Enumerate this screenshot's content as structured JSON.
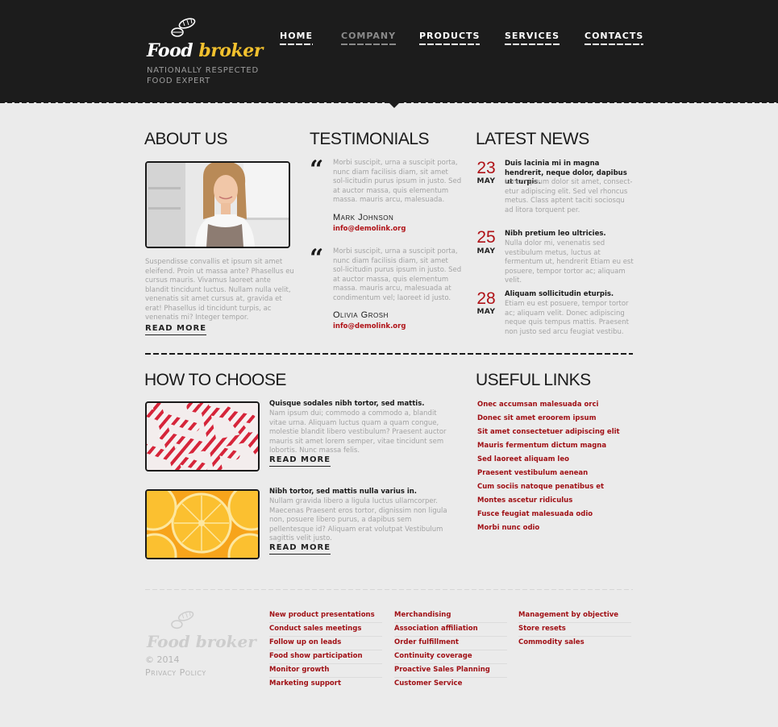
{
  "brand": {
    "word1": "Food",
    "word2": "broker",
    "slogan": "NATIONALLY RESPECTED FOOD EXPERT"
  },
  "nav": {
    "items": [
      {
        "label": "HOME"
      },
      {
        "label": "COMPANY"
      },
      {
        "label": "PRODUCTS"
      },
      {
        "label": "SERVICES"
      },
      {
        "label": "CONTACTS"
      }
    ],
    "active": "COMPANY"
  },
  "about": {
    "title": "ABOUT US",
    "text": "Suspendisse convallis et ipsum sit amet eleifend. Proin ut massa ante? Phasellus eu cursus mauris. Vivamus laoreet ante blandit tincidunt luctus. Nullam nulla velit, venenatis sit amet cursus at, gravida et erat! Phasellus id tincidunt turpis, ac venenatis mi? Integer tempor.",
    "more": "READ MORE"
  },
  "testimonials": {
    "title": "TESTIMONIALS",
    "items": [
      {
        "text": "Morbi suscipit, urna a suscipit porta, nunc diam facilisis diam, sit amet sol-licitudin purus ipsum in justo. Sed at auctor massa, quis elementum massa. mauris arcu, malesuada.",
        "name": "Mark Johnson",
        "email": "info@demolink.org"
      },
      {
        "text": "Morbi suscipit, urna a suscipit porta, nunc diam facilisis diam, sit amet sol-licitudin purus ipsum in justo. Sed at auctor massa, quis elementum massa. mauris arcu, malesuada at condimentum vel; laoreet id justo.",
        "name": "Olivia Grosh",
        "email": "info@demolink.org"
      }
    ]
  },
  "news": {
    "title": "LATEST NEWS",
    "items": [
      {
        "day": "23",
        "month": "MAY",
        "title": "Duis lacinia mi in magna hendrerit, neque dolor, dapibus ut turpis.",
        "text": "Lorem ipsum dolor sit amet, consect-etur adipiscing elit. Sed vel rhoncus metus. Class aptent taciti sociosqu ad litora torquent per."
      },
      {
        "day": "25",
        "month": "MAY",
        "title": "Nibh pretium leo ultricies.",
        "text": "Nulla dolor mi, venenatis sed vestibulum metus, luctus at fermentum ut, hendrerit Etiam eu est posuere, tempor tortor ac; aliquam velit."
      },
      {
        "day": "28",
        "month": "MAY",
        "title": "Aliquam sollicitudin eturpis.",
        "text": "Etiam eu est posuere, tempor tortor ac; aliquam velit. Donec adipiscing neque quis tempus mattis. Praesent non justo sed arcu feugiat vestibu."
      }
    ]
  },
  "choose": {
    "title": "HOW TO CHOOSE",
    "items": [
      {
        "title": "Quisque sodales nibh tortor, sed mattis.",
        "text": "Nam ipsum dui; commodo a commodo a, blandit vitae urna. Aliquam luctus quam a quam congue, molestie blandit libero vestibulum? Praesent auctor mauris sit amet lorem semper, vitae tincidunt sem lobortis. Nunc massa felis.",
        "more": "READ MORE"
      },
      {
        "title": "Nibh tortor, sed mattis nulla varius in.",
        "text": "Nullam gravida libero a ligula luctus ullamcorper. Maecenas Praesent eros tortor, dignissim non ligula non, posuere libero purus, a dapibus sem pellentesque id? Aliquam erat volutpat Vestibulum sagittis velit justo.",
        "more": "READ MORE"
      }
    ]
  },
  "useful": {
    "title": "USEFUL LINKS",
    "links": [
      "Onec accumsan malesuada orci",
      "Donec sit amet eroorem ipsum",
      "Sit amet consectetuer adipiscing elit",
      "Mauris fermentum dictum magna",
      "Sed laoreet aliquam leo",
      "Praesent vestibulum aenean",
      "Cum sociis natoque penatibus et",
      "Montes ascetur ridiculus",
      "Fusce feugiat malesuada odio",
      "Morbi nunc odio"
    ]
  },
  "footer": {
    "copyright": "© 2014",
    "privacy": "Privacy Policy",
    "col1": [
      "New product presentations",
      "Conduct sales meetings",
      "Follow up on leads",
      "Food show participation",
      "Monitor growth",
      "Marketing support"
    ],
    "col2": [
      "Merchandising",
      "Association affiliation",
      "Order fulfillment",
      "Continuity coverage",
      "Proactive Sales Planning",
      "Customer Service"
    ],
    "col3": [
      "Management by objective",
      "Store resets",
      "Commodity sales"
    ]
  },
  "colors": {
    "accent": "#b01217",
    "header_bg": "#1c1c1c",
    "logo_yellow": "#f2c12e",
    "page_bg": "#ebebeb"
  }
}
